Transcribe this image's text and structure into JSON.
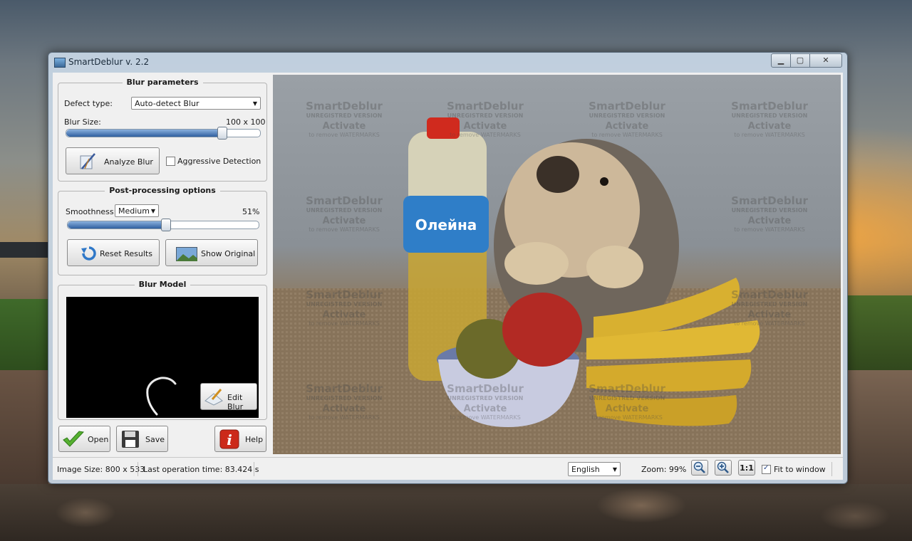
{
  "window": {
    "title": "SmartDeblur v. 2.2"
  },
  "blur_parameters": {
    "title": "Blur parameters",
    "defect_type_label": "Defect type:",
    "defect_type_value": "Auto-detect Blur",
    "blur_size_label": "Blur Size:",
    "blur_size_value": "100 x 100",
    "blur_size_fraction": 0.8,
    "analyze_button": "Analyze Blur",
    "aggressive_label": "Aggressive Detection",
    "aggressive_checked": false
  },
  "post_processing": {
    "title": "Post-processing options",
    "smoothness_label": "Smoothness:",
    "smoothness_value": "Medium",
    "smoothness_percent": "51%",
    "smoothness_fraction": 0.51,
    "reset_button": "Reset Results",
    "show_original_button": "Show Original"
  },
  "blur_model": {
    "title": "Blur Model",
    "edit_button": "Edit Blur"
  },
  "bottom_buttons": {
    "open": "Open",
    "save": "Save",
    "help": "Help"
  },
  "watermark": {
    "line1": "SmartDeblur",
    "line2": "UNREGISTRED VERSION",
    "line3": "Activate",
    "line4": "to remove WATERMARKS"
  },
  "bottle_label": "Олейна",
  "statusbar": {
    "image_size": "Image Size: 800 x 533",
    "last_operation": "Last operation time: 83.424 s",
    "language": "English",
    "zoom": "Zoom: 99%",
    "one_to_one": "1:1",
    "fit_to_window": "Fit to window",
    "fit_checked": true
  },
  "icons": [
    "window-app-icon",
    "minimize-icon",
    "maximize-icon",
    "close-icon",
    "analyze-icon",
    "reset-icon",
    "original-image-icon",
    "edit-blur-icon",
    "open-check-icon",
    "save-disk-icon",
    "help-icon",
    "zoom-out-icon",
    "zoom-in-icon"
  ]
}
